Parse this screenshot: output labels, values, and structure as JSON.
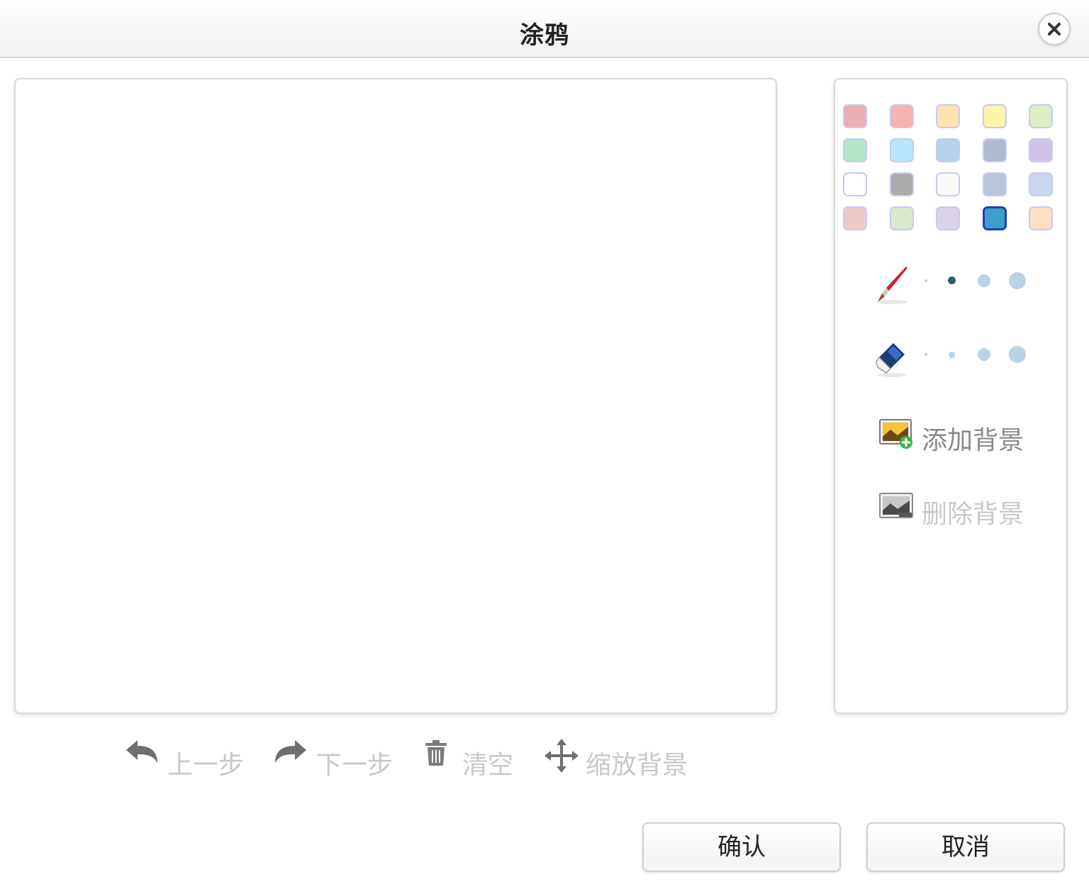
{
  "dialog": {
    "title": "涂鸦",
    "close_icon": "close-icon"
  },
  "palette": {
    "colors": [
      "#e8b0b0",
      "#f8b2b2",
      "#fde2b0",
      "#fdf6a8",
      "#dcecc4",
      "#b2e6c8",
      "#b6e6fa",
      "#b6d2ec",
      "#aebacd",
      "#d2c2e8",
      "#ffffff",
      "#ababab",
      "#fafaf6",
      "#b9c4d8",
      "#cad8ee",
      "#f0c8c8",
      "#dce8cc",
      "#dcd2e8",
      "#3aa2c8",
      "#fce0c4"
    ],
    "selected_index": 18
  },
  "brush": {
    "icon": "brush-icon",
    "sizes": 4,
    "selected_size": 2
  },
  "eraser": {
    "icon": "eraser-icon",
    "sizes": 4,
    "selected_size": 0
  },
  "background": {
    "add_label": "添加背景",
    "delete_label": "删除背景"
  },
  "toolbar": {
    "undo_label": "上一步",
    "redo_label": "下一步",
    "clear_label": "清空",
    "zoom_bg_label": "缩放背景"
  },
  "buttons": {
    "confirm_label": "确认",
    "cancel_label": "取消"
  }
}
